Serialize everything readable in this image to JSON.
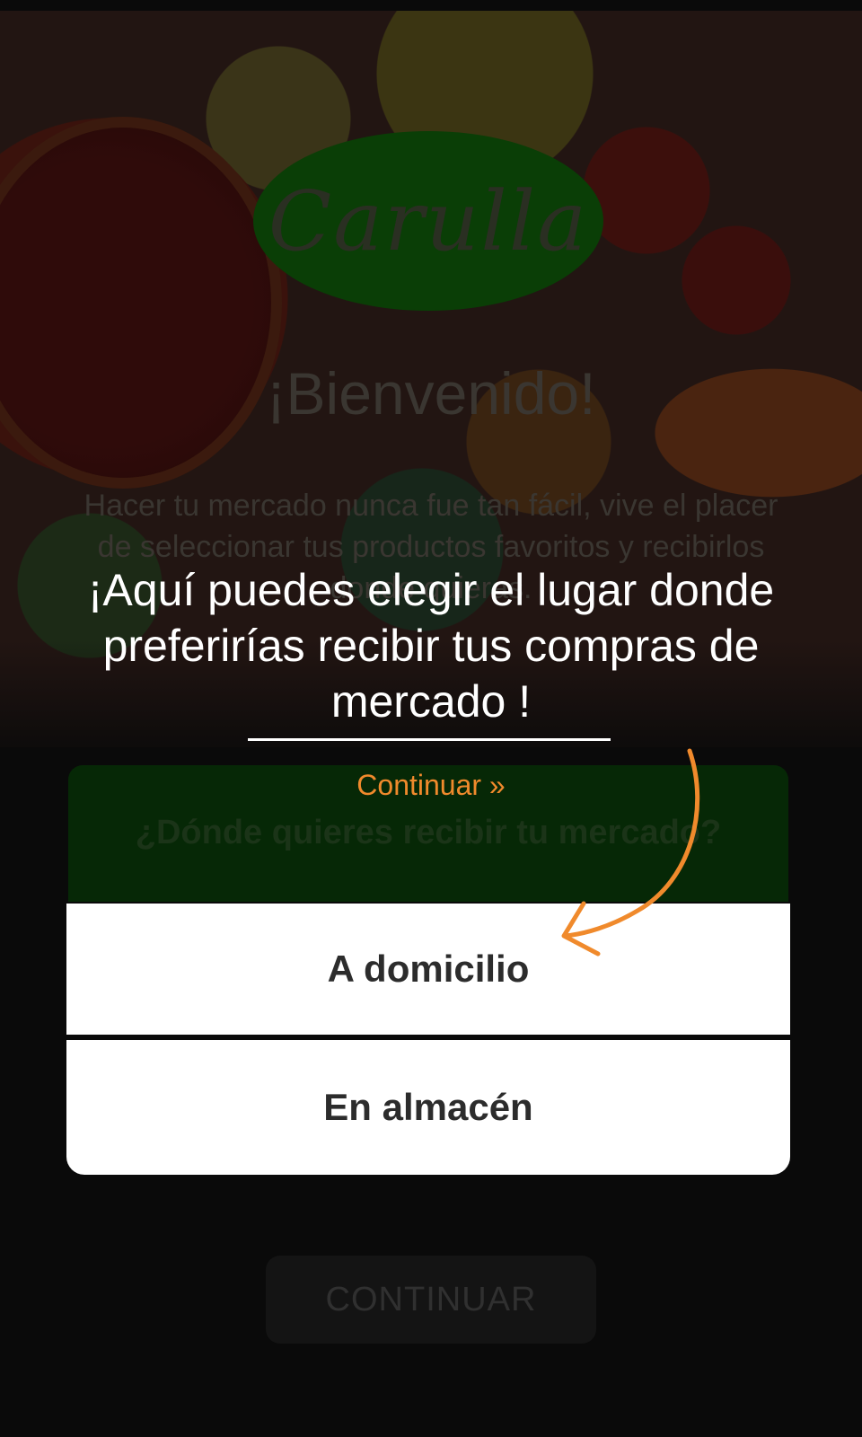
{
  "brand": {
    "logo_text": "Carulla",
    "color": "#0a3e06"
  },
  "welcome": {
    "title": "¡Bienvenido!",
    "description": "Hacer tu mercado nunca fue tan fácil, vive el placer de seleccionar tus productos favoritos y recibirlos donde quieras."
  },
  "delivery_card": {
    "question": "¿Dónde quieres recibir tu mercado?",
    "options": [
      {
        "label": "A domicilio"
      },
      {
        "label": "En almacén"
      }
    ]
  },
  "continue_button": {
    "label": "CONTINUAR"
  },
  "coachmark": {
    "message": "¡Aquí puedes elegir el lugar donde preferirías recibir tus compras de mercado !",
    "continue_link": "Continuar »",
    "accent_color": "#f08a2c",
    "arrow_icon": "curved-arrow-icon"
  }
}
